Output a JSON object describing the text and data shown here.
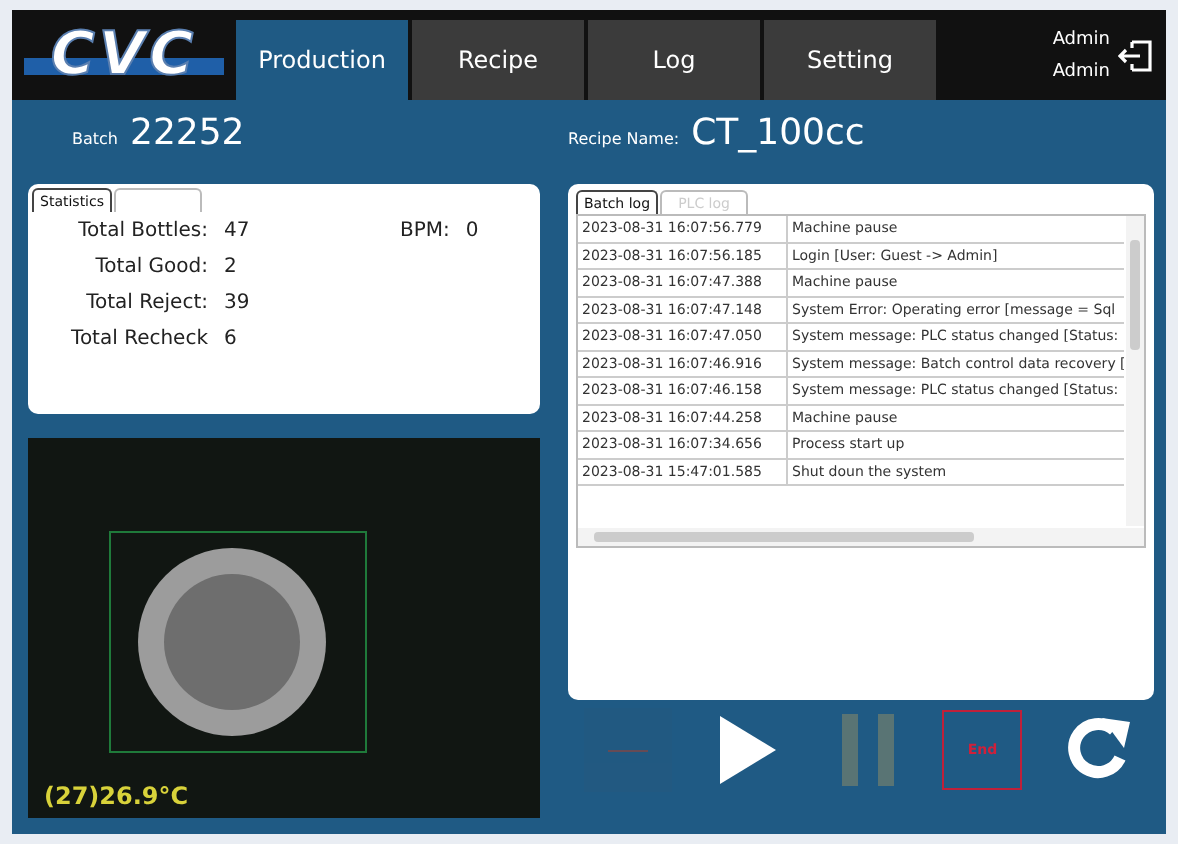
{
  "header": {
    "logo": "CVC",
    "tabs": [
      {
        "label": "Production",
        "selected": true
      },
      {
        "label": "Recipe",
        "selected": false
      },
      {
        "label": "Log",
        "selected": false
      },
      {
        "label": "Setting",
        "selected": false
      }
    ],
    "user": {
      "name": "Admin",
      "role": "Admin"
    }
  },
  "batch": {
    "label": "Batch",
    "value": "22252"
  },
  "recipe": {
    "label": "Recipe Name:",
    "value": "CT_100cc"
  },
  "statistics": {
    "tabs": [
      {
        "label": "Statistics",
        "selected": true
      },
      {
        "selected": false
      }
    ],
    "rows": [
      {
        "label": "Total Bottles:",
        "value": "47"
      },
      {
        "label": "Total Good:",
        "value": "2"
      },
      {
        "label": "Total Reject:",
        "value": "39"
      },
      {
        "label": "Total Recheck",
        "value": "6"
      }
    ],
    "bpm": {
      "label": "BPM:",
      "value": "0"
    }
  },
  "log": {
    "tabs": [
      {
        "label": "Batch log",
        "selected": true
      },
      {
        "label": "PLC log",
        "selected": false
      }
    ],
    "rows": [
      {
        "time": "2023-08-31 16:07:56.779",
        "message": "Machine pause"
      },
      {
        "time": "2023-08-31 16:07:56.185",
        "message": "Login [User: Guest -> Admin]"
      },
      {
        "time": "2023-08-31 16:07:47.388",
        "message": "Machine pause"
      },
      {
        "time": "2023-08-31 16:07:47.148",
        "message": "System Error: Operating error [message = Sql"
      },
      {
        "time": "2023-08-31 16:07:47.050",
        "message": "System message: PLC status changed [Status:"
      },
      {
        "time": "2023-08-31 16:07:46.916",
        "message": "System message: Batch control data recovery ["
      },
      {
        "time": "2023-08-31 16:07:46.158",
        "message": "System message: PLC status changed [Status:"
      },
      {
        "time": "2023-08-31 16:07:44.258",
        "message": "Machine pause"
      },
      {
        "time": "2023-08-31 16:07:34.656",
        "message": "Process start up"
      },
      {
        "time": "2023-08-31 15:47:01.585",
        "message": "Shut doun the system"
      }
    ]
  },
  "camera": {
    "reading": "(27)26.9°C"
  },
  "controls": [
    {
      "kind": "blank",
      "disabled": true
    },
    {
      "kind": "play",
      "disabled": false
    },
    {
      "kind": "pause",
      "disabled": true
    },
    {
      "kind": "end",
      "label": "End",
      "disabled": false
    },
    {
      "kind": "refresh",
      "disabled": false
    }
  ]
}
